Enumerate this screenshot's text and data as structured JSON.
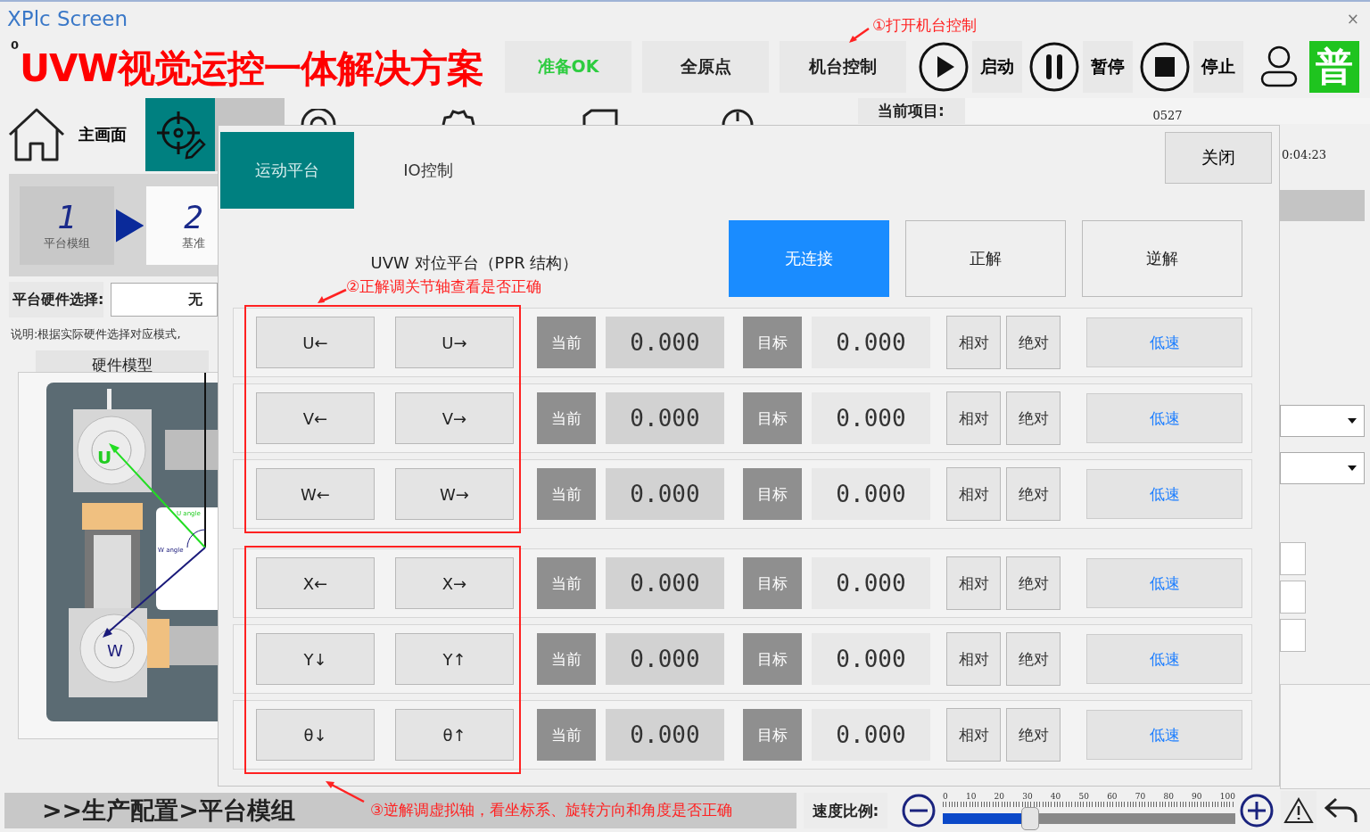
{
  "window": {
    "title": "XPlc Screen",
    "close": "×"
  },
  "header": {
    "counter": "0",
    "app_title": "UVW视觉运控一体解决方案",
    "buttons": [
      {
        "label": "准备OK",
        "kind": "status"
      },
      {
        "label": "全原点",
        "kind": "plain"
      },
      {
        "label": "机台控制",
        "kind": "plain"
      }
    ],
    "controls": [
      {
        "label": "启动",
        "kind": "play"
      },
      {
        "label": "暂停",
        "kind": "pause"
      },
      {
        "label": "停止",
        "kind": "stop"
      }
    ],
    "user_level": "普"
  },
  "nav": {
    "home": "主画面",
    "tiles": [
      {
        "kind": "target",
        "selected": true
      },
      {
        "kind": "blank",
        "selected": false
      }
    ]
  },
  "project": {
    "label": "当前项目:",
    "value": "0527",
    "time": "0:04:23"
  },
  "steps": [
    {
      "number": "1",
      "label": "平台模组",
      "selected": true
    },
    {
      "number": "2",
      "label": "基准",
      "selected": false
    }
  ],
  "hardware": {
    "label": "平台硬件选择:",
    "value": "无",
    "note": "说明:根据实际硬件选择对应模式,",
    "model_title": "硬件模型",
    "model_labels": [
      "U",
      "W",
      "U angle",
      "W angle"
    ]
  },
  "dialog": {
    "tabs": [
      {
        "label": "运动平台",
        "selected": true
      },
      {
        "label": "IO控制",
        "selected": false
      }
    ],
    "close": "关闭",
    "title": "UVW 对位平台（PPR 结构）",
    "modes": [
      {
        "label": "无连接",
        "selected": true
      },
      {
        "label": "正解",
        "selected": false
      },
      {
        "label": "逆解",
        "selected": false
      }
    ],
    "groups": [
      {
        "highlighted": true,
        "rows": [
          {
            "neg": "U←",
            "pos": "U→",
            "current_label": "当前",
            "current": "0.000",
            "target_label": "目标",
            "target": "0.000",
            "relative": "相对",
            "absolute": "绝对",
            "speed": "低速"
          },
          {
            "neg": "V←",
            "pos": "V→",
            "current_label": "当前",
            "current": "0.000",
            "target_label": "目标",
            "target": "0.000",
            "relative": "相对",
            "absolute": "绝对",
            "speed": "低速"
          },
          {
            "neg": "W←",
            "pos": "W→",
            "current_label": "当前",
            "current": "0.000",
            "target_label": "目标",
            "target": "0.000",
            "relative": "相对",
            "absolute": "绝对",
            "speed": "低速"
          }
        ]
      },
      {
        "highlighted": true,
        "rows": [
          {
            "neg": "X←",
            "pos": "X→",
            "current_label": "当前",
            "current": "0.000",
            "target_label": "目标",
            "target": "0.000",
            "relative": "相对",
            "absolute": "绝对",
            "speed": "低速"
          },
          {
            "neg": "Y↓",
            "pos": "Y↑",
            "current_label": "当前",
            "current": "0.000",
            "target_label": "目标",
            "target": "0.000",
            "relative": "相对",
            "absolute": "绝对",
            "speed": "低速"
          },
          {
            "neg": "θ↓",
            "pos": "θ↑",
            "current_label": "当前",
            "current": "0.000",
            "target_label": "目标",
            "target": "0.000",
            "relative": "相对",
            "absolute": "绝对",
            "speed": "低速"
          }
        ]
      }
    ]
  },
  "breadcrumb": ">>生产配置>平台模组",
  "speed": {
    "label": "速度比例:",
    "level": 0.3,
    "ticks": [
      "0",
      "10",
      "20",
      "30",
      "40",
      "50",
      "60",
      "70",
      "80",
      "90",
      "100"
    ]
  },
  "callouts": [
    {
      "text": "①打开机台控制"
    },
    {
      "text": "②正解调关节轴查看是否正确"
    },
    {
      "text": "③逆解调虚拟轴，看坐标系、旋转方向和角度是否正确"
    }
  ]
}
